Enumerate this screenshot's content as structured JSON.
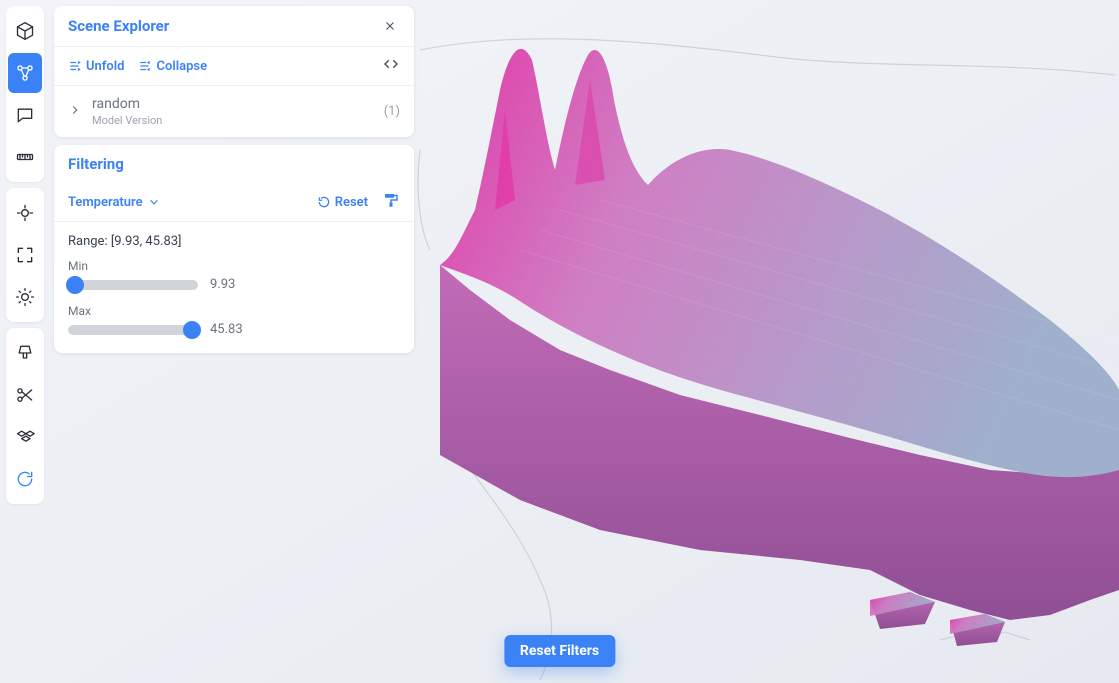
{
  "toolbar": {
    "icons": [
      "cube",
      "graph",
      "chat",
      "ruler",
      "compass",
      "expand",
      "sun",
      "lamp",
      "scissors",
      "boxes",
      "rotate"
    ]
  },
  "sceneExplorer": {
    "title": "Scene Explorer",
    "unfold_label": "Unfold",
    "collapse_label": "Collapse",
    "tree": {
      "name": "random",
      "subtitle": "Model Version",
      "count": "(1)"
    }
  },
  "filtering": {
    "title": "Filtering",
    "property_label": "Temperature",
    "reset_label": "Reset",
    "range_text": "Range: [9.93, 45.83]",
    "min_label": "Min",
    "min_value": "9.93",
    "min_position_pct": 5,
    "max_label": "Max",
    "max_value": "45.83",
    "max_position_pct": 95
  },
  "reset_filters_label": "Reset Filters"
}
